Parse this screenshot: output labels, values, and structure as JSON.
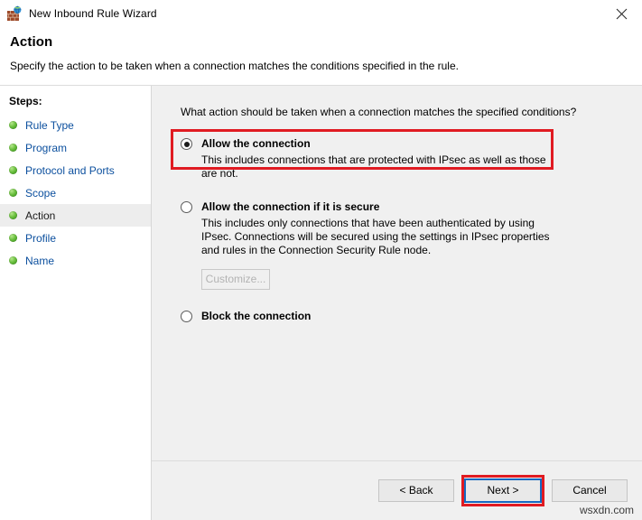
{
  "window": {
    "title": "New Inbound Rule Wizard",
    "icon": "firewall-globe-icon",
    "close_label": "✕"
  },
  "header": {
    "title": "Action",
    "description": "Specify the action to be taken when a connection matches the conditions specified in the rule."
  },
  "sidebar": {
    "title": "Steps:",
    "items": [
      {
        "label": "Rule Type",
        "current": false
      },
      {
        "label": "Program",
        "current": false
      },
      {
        "label": "Protocol and Ports",
        "current": false
      },
      {
        "label": "Scope",
        "current": false
      },
      {
        "label": "Action",
        "current": true
      },
      {
        "label": "Profile",
        "current": false
      },
      {
        "label": "Name",
        "current": false
      }
    ]
  },
  "main": {
    "question": "What action should be taken when a connection matches the specified conditions?",
    "options": [
      {
        "title": "Allow the connection",
        "description": "This includes connections that are protected with IPsec as well as those are not.",
        "selected": true,
        "highlighted": true
      },
      {
        "title": "Allow the connection if it is secure",
        "description": "This includes only connections that have been authenticated by using IPsec.  Connections will be secured using the settings in IPsec properties and rules in the Connection Security Rule node.",
        "selected": false,
        "highlighted": false
      },
      {
        "title": "Block the connection",
        "description": "",
        "selected": false,
        "highlighted": false
      }
    ],
    "customize_label": "Customize...",
    "customize_enabled": false
  },
  "footer": {
    "back_label": "< Back",
    "next_label": "Next >",
    "cancel_label": "Cancel",
    "watermark": "wsxdn.com"
  },
  "colors": {
    "highlight_red": "#e01b22",
    "link_blue": "#0b4f9e",
    "panel_gray": "#f0f0f0",
    "focus_blue": "#1669c1"
  }
}
